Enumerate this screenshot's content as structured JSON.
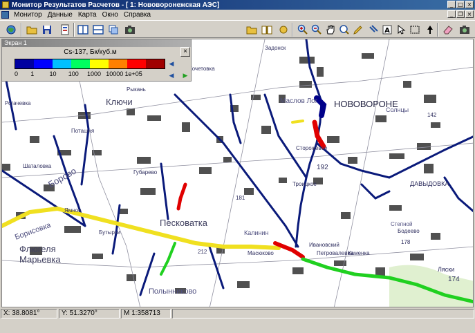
{
  "window": {
    "title": "Монитор Результатов Расчетов - [ 1: Нововоронежская АЭС]"
  },
  "menu": {
    "items": [
      "Монитор",
      "Данные",
      "Карта",
      "Окно",
      "Справка"
    ]
  },
  "legend": {
    "panel_title": "Экран 1",
    "title": "Cs-137, Бк/куб.м",
    "close_label": "×",
    "colors": [
      "#0000a0",
      "#0000ff",
      "#00c0ff",
      "#00ff60",
      "#ffff00",
      "#ff8000",
      "#ff0000",
      "#a00000"
    ],
    "ticks": [
      "0",
      "1",
      "10",
      "100",
      "1000",
      "10000",
      "1e+05"
    ]
  },
  "toolbar": {
    "icons": [
      "globe-icon",
      "open-folder-icon",
      "save-icon",
      "report-icon",
      "tile-vertical-icon",
      "tile-horizontal-icon",
      "layers-icon",
      "camera-icon",
      "open-folder-icon",
      "book-icon",
      "globe-small-icon",
      "zoom-in-icon",
      "zoom-out-icon",
      "pan-hand-icon",
      "zoom-extent-icon",
      "pencil-icon",
      "fill-icon",
      "text-icon",
      "select-arrow-icon",
      "box-select-icon",
      "up-arrow-icon",
      "eraser-icon",
      "camera-icon"
    ]
  },
  "map": {
    "labels": [
      {
        "text": "НОВОВОРОНЕ",
        "big": true
      },
      {
        "text": "Ключи",
        "big": true
      },
      {
        "text": "Песковатка",
        "big": true
      },
      {
        "text": "Флюгеля",
        "big": true
      },
      {
        "text": "Марьевка",
        "big": true
      },
      {
        "text": "Борово",
        "big": true
      },
      {
        "text": "Борисовка",
        "big": false
      },
      {
        "text": "Полынниково",
        "big": false
      },
      {
        "text": "ДАВЫДОВКА",
        "big": false
      },
      {
        "text": "Маслов Лог",
        "big": false
      },
      {
        "text": "Солнцы",
        "big": false
      },
      {
        "text": "Ляски",
        "big": false
      },
      {
        "text": "Калинин",
        "big": false
      },
      {
        "text": "Рогачевка",
        "big": false
      },
      {
        "text": "Шаталовка",
        "big": false
      },
      {
        "text": "Степной",
        "big": false
      },
      {
        "text": "Бодеево",
        "big": false
      },
      {
        "text": "Рыкань",
        "big": false
      },
      {
        "text": "Поташня",
        "big": false
      },
      {
        "text": "Масюково",
        "big": false
      },
      {
        "text": "Каменка",
        "big": false
      },
      {
        "text": "Бутырки",
        "big": false
      },
      {
        "text": "Ямное",
        "big": false
      },
      {
        "text": "Губарево",
        "big": false
      },
      {
        "text": "Задонск",
        "big": false
      },
      {
        "text": "Кочетовка",
        "big": false
      },
      {
        "text": "Ивановский",
        "big": false
      },
      {
        "text": "Петровалевка",
        "big": false
      },
      {
        "text": "Сторожевое",
        "big": false
      },
      {
        "text": "Троицкое",
        "big": false
      },
      {
        "text": "192",
        "big": false
      },
      {
        "text": "174",
        "big": false
      },
      {
        "text": "181",
        "big": false
      },
      {
        "text": "212",
        "big": false
      },
      {
        "text": "178",
        "big": false
      },
      {
        "text": "142",
        "big": false
      }
    ]
  },
  "status": {
    "x": "X: 38.8081°",
    "y": "Y: 51.3270°",
    "scale": "M 1:358713"
  }
}
